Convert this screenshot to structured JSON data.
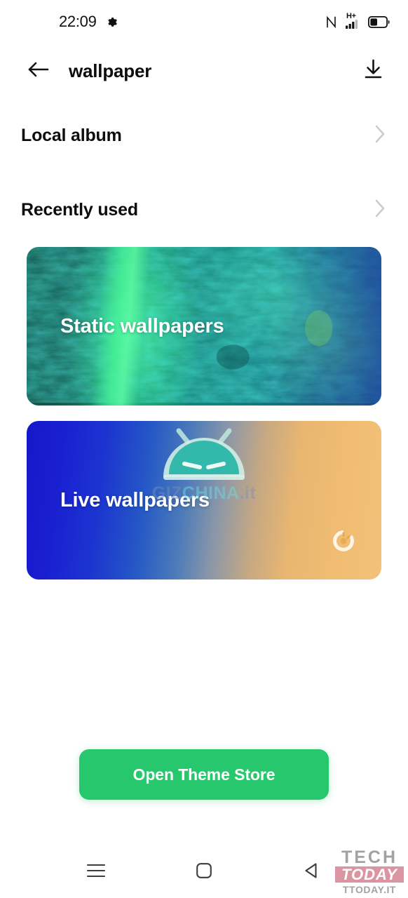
{
  "status_bar": {
    "time": "22:09",
    "settings_icon": "gear-icon",
    "nfc_icon": "nfc-icon",
    "network_label": "H+",
    "signal_icon": "signal-bars-icon",
    "battery_icon": "battery-icon",
    "battery_level_pct": 40
  },
  "app_bar": {
    "back_icon": "arrow-left-icon",
    "title": "wallpaper",
    "download_icon": "download-icon"
  },
  "list": {
    "items": [
      {
        "label": "Local album",
        "chevron": "chevron-right-icon"
      },
      {
        "label": "Recently used",
        "chevron": "chevron-right-icon"
      }
    ]
  },
  "cards": [
    {
      "label": "Static wallpapers",
      "kind": "static",
      "accent": "#16937a"
    },
    {
      "label": "Live wallpapers",
      "kind": "live",
      "accent": "#1a1fd2",
      "badge_icon": "loading-spinner-icon"
    }
  ],
  "cta": {
    "label": "Open Theme Store",
    "color": "#27c76d"
  },
  "nav_bar": {
    "recents_icon": "menu-lines-icon",
    "home_icon": "square-home-icon",
    "back_icon": "triangle-back-icon"
  },
  "watermarks": {
    "gizchina": {
      "robot_icon": "android-robot-icon",
      "part1": "GIZ",
      "part2": "CHINA",
      "part3": ".it"
    },
    "techtoday": {
      "line1": "TECH",
      "line2": "TODAY",
      "line3": "TTODAY.IT"
    }
  }
}
